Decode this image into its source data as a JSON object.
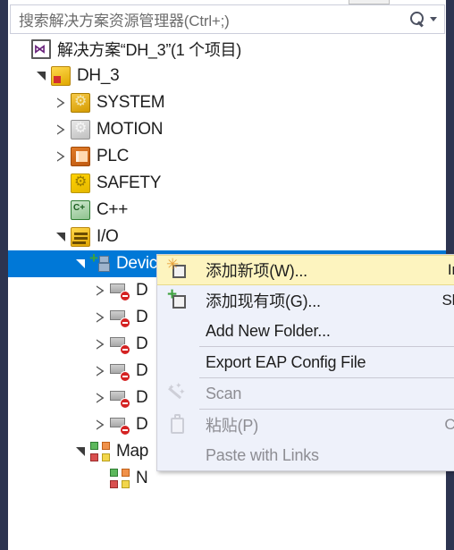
{
  "window": {
    "accent_selection": "#0078d7",
    "frame_color": "#2d3450",
    "highlight_color": "#fdf4bf"
  },
  "search": {
    "placeholder": "搜索解决方案资源管理器(Ctrl+;)",
    "value": "",
    "icon": "search-icon",
    "dropdown_icon": "chevron-down-icon"
  },
  "tree": {
    "items": [
      {
        "label": "解决方案“DH_3”(1 个项目)",
        "icon": "visual-studio-solution-icon",
        "indent": 0,
        "twisty": "none",
        "selected": false
      },
      {
        "label": "DH_3",
        "icon": "project-icon",
        "indent": 1,
        "twisty": "expanded",
        "selected": false
      },
      {
        "label": "SYSTEM",
        "icon": "system-icon",
        "indent": 2,
        "twisty": "collapsed",
        "selected": false
      },
      {
        "label": "MOTION",
        "icon": "motion-icon",
        "indent": 2,
        "twisty": "collapsed",
        "selected": false
      },
      {
        "label": "PLC",
        "icon": "plc-icon",
        "indent": 2,
        "twisty": "collapsed",
        "selected": false
      },
      {
        "label": "SAFETY",
        "icon": "safety-icon",
        "indent": 2,
        "twisty": "none",
        "selected": false
      },
      {
        "label": "C++",
        "icon": "cpp-icon",
        "indent": 2,
        "twisty": "none",
        "selected": false
      },
      {
        "label": "I/O",
        "icon": "io-icon",
        "indent": 2,
        "twisty": "expanded",
        "selected": false
      },
      {
        "label": "Devices",
        "icon": "devices-icon",
        "indent": 3,
        "twisty": "expanded",
        "selected": true
      },
      {
        "label": "D",
        "icon": "device-icon",
        "indent": 4,
        "twisty": "collapsed",
        "selected": false
      },
      {
        "label": "D",
        "icon": "device-icon",
        "indent": 4,
        "twisty": "collapsed",
        "selected": false
      },
      {
        "label": "D",
        "icon": "device-icon",
        "indent": 4,
        "twisty": "collapsed",
        "selected": false
      },
      {
        "label": "D",
        "icon": "device-icon",
        "indent": 4,
        "twisty": "collapsed",
        "selected": false
      },
      {
        "label": "D",
        "icon": "device-icon",
        "indent": 4,
        "twisty": "collapsed",
        "selected": false
      },
      {
        "label": "D",
        "icon": "device-icon",
        "indent": 4,
        "twisty": "collapsed",
        "selected": false
      },
      {
        "label": "Map",
        "icon": "mappings-icon",
        "indent": 3,
        "twisty": "expanded",
        "selected": false
      },
      {
        "label": "N",
        "icon": "mapping-item-icon",
        "indent": 4,
        "twisty": "none",
        "selected": false
      }
    ]
  },
  "context_menu": {
    "items": [
      {
        "label": "添加新项(W)...",
        "shortcut": "Ins",
        "icon": "add-new-item-icon",
        "disabled": false,
        "highlighted": true,
        "separator_before": false
      },
      {
        "label": "添加现有项(G)...",
        "shortcut": "Shif",
        "icon": "add-existing-item-icon",
        "disabled": false,
        "highlighted": false,
        "separator_before": false
      },
      {
        "label": "Add New Folder...",
        "shortcut": "",
        "icon": "",
        "disabled": false,
        "highlighted": false,
        "separator_before": false
      },
      {
        "label": "Export EAP Config File",
        "shortcut": "",
        "icon": "",
        "disabled": false,
        "highlighted": false,
        "separator_before": true
      },
      {
        "label": "Scan",
        "shortcut": "",
        "icon": "wand-icon",
        "disabled": true,
        "highlighted": false,
        "separator_before": true
      },
      {
        "label": "粘贴(P)",
        "shortcut": "Ctrl",
        "icon": "clipboard-icon",
        "disabled": true,
        "highlighted": false,
        "separator_before": true
      },
      {
        "label": "Paste with Links",
        "shortcut": "",
        "icon": "",
        "disabled": true,
        "highlighted": false,
        "separator_before": false
      }
    ]
  }
}
